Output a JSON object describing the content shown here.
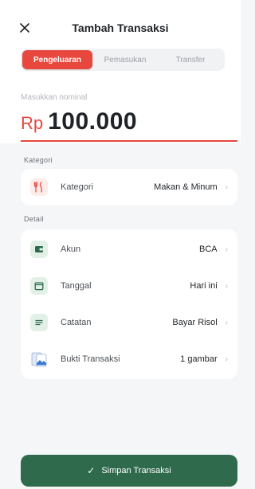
{
  "header": {
    "title": "Tambah Transaksi",
    "close_icon": "close-icon",
    "tabs": [
      {
        "label": "Pengeluaran",
        "active": true
      },
      {
        "label": "Pemasukan",
        "active": false
      },
      {
        "label": "Transfer",
        "active": false
      }
    ]
  },
  "amount": {
    "placeholder_label": "Masukkan nominal",
    "currency": "Rp",
    "value": "100.000"
  },
  "category": {
    "section_label": "Kategori",
    "row": {
      "icon": "utensils-icon",
      "label": "Kategori",
      "value": "Makan & Minum"
    }
  },
  "detail": {
    "section_label": "Detail",
    "rows": [
      {
        "icon": "wallet-icon",
        "label": "Akun",
        "value": "BCA"
      },
      {
        "icon": "calendar-icon",
        "label": "Tanggal",
        "value": "Hari ini"
      },
      {
        "icon": "notes-icon",
        "label": "Catatan",
        "value": "Bayar Risol"
      },
      {
        "icon": "receipt-image-icon",
        "label": "Bukti Transaksi",
        "value": "1 gambar"
      }
    ]
  },
  "footer": {
    "save_label": "Simpan Transaksi",
    "check_icon": "check-icon"
  },
  "colors": {
    "accent_red": "#e8473d",
    "save_green": "#2f6a4d",
    "icon_green_bg": "#e3f0e8",
    "icon_green": "#2f6a4d"
  }
}
